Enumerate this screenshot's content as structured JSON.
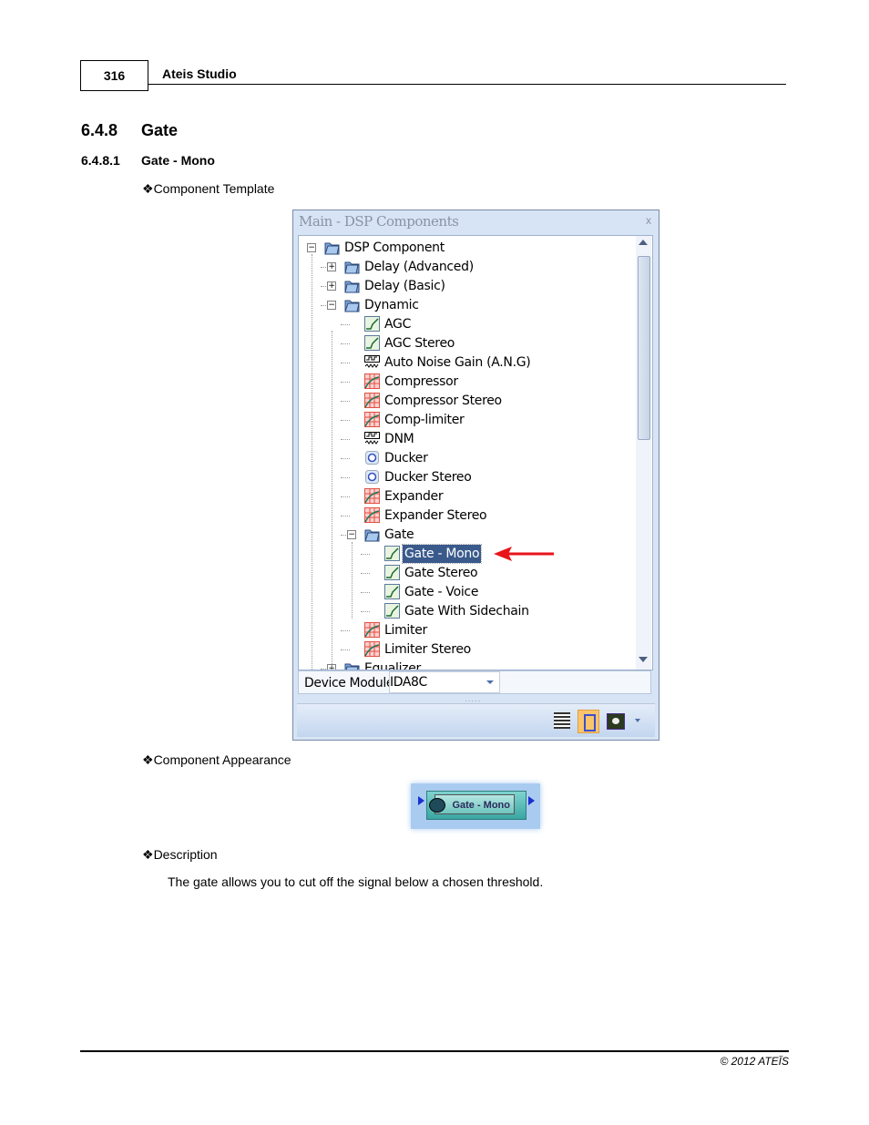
{
  "header": {
    "page_number": "316",
    "title": "Ateis Studio"
  },
  "section": {
    "number": "6.4.8",
    "title": "Gate"
  },
  "subsection": {
    "number": "6.4.8.1",
    "title": "Gate - Mono"
  },
  "bullets": {
    "template": "Component Template",
    "appearance": "Component Appearance",
    "description": "Description"
  },
  "bullet_glyph": "❖",
  "window": {
    "title": "Main - DSP Components",
    "close": "x",
    "tree": [
      {
        "label": "DSP Component",
        "level": 0,
        "icon": "folder-open-icon",
        "expander": "minus"
      },
      {
        "label": "Delay (Advanced)",
        "level": 1,
        "icon": "folder-icon",
        "expander": "plus"
      },
      {
        "label": "Delay (Basic)",
        "level": 1,
        "icon": "folder-icon",
        "expander": "plus"
      },
      {
        "label": "Dynamic",
        "level": 1,
        "icon": "folder-open-icon",
        "expander": "minus"
      },
      {
        "label": "AGC",
        "level": 2,
        "icon": "gate-icon"
      },
      {
        "label": "AGC Stereo",
        "level": 2,
        "icon": "gate-icon"
      },
      {
        "label": "Auto Noise Gain (A.N.G)",
        "level": 2,
        "icon": "noise-icon"
      },
      {
        "label": "Compressor",
        "level": 2,
        "icon": "compressor-icon"
      },
      {
        "label": "Compressor Stereo",
        "level": 2,
        "icon": "compressor-icon"
      },
      {
        "label": "Comp-limiter",
        "level": 2,
        "icon": "compressor-icon"
      },
      {
        "label": "DNM",
        "level": 2,
        "icon": "noise-icon"
      },
      {
        "label": "Ducker",
        "level": 2,
        "icon": "ducker-icon"
      },
      {
        "label": "Ducker Stereo",
        "level": 2,
        "icon": "ducker-icon"
      },
      {
        "label": "Expander",
        "level": 2,
        "icon": "compressor-icon"
      },
      {
        "label": "Expander Stereo",
        "level": 2,
        "icon": "compressor-icon"
      },
      {
        "label": "Gate",
        "level": 2,
        "icon": "folder-open-icon",
        "expander": "minus"
      },
      {
        "label": "Gate - Mono",
        "level": 3,
        "icon": "gate-icon",
        "selected": true
      },
      {
        "label": "Gate Stereo",
        "level": 3,
        "icon": "gate-icon"
      },
      {
        "label": "Gate - Voice",
        "level": 3,
        "icon": "gate-icon"
      },
      {
        "label": "Gate With Sidechain",
        "level": 3,
        "icon": "gate-icon"
      },
      {
        "label": "Limiter",
        "level": 2,
        "icon": "compressor-icon"
      },
      {
        "label": "Limiter Stereo",
        "level": 2,
        "icon": "compressor-icon"
      },
      {
        "label": "Equalizer",
        "level": 1,
        "icon": "folder-icon",
        "expander": "plus"
      }
    ],
    "device_module_label": "Device Module",
    "device_module_value": "IDA8C"
  },
  "component": {
    "label": "Gate - Mono"
  },
  "description": "The gate allows you to cut off the signal below a chosen threshold.",
  "footer": {
    "copyright": "© 2012 ATEÏS"
  },
  "colors": {
    "arrow": "#e8141a",
    "selection": "#3a5a8c",
    "component": "#3aa6a2"
  }
}
